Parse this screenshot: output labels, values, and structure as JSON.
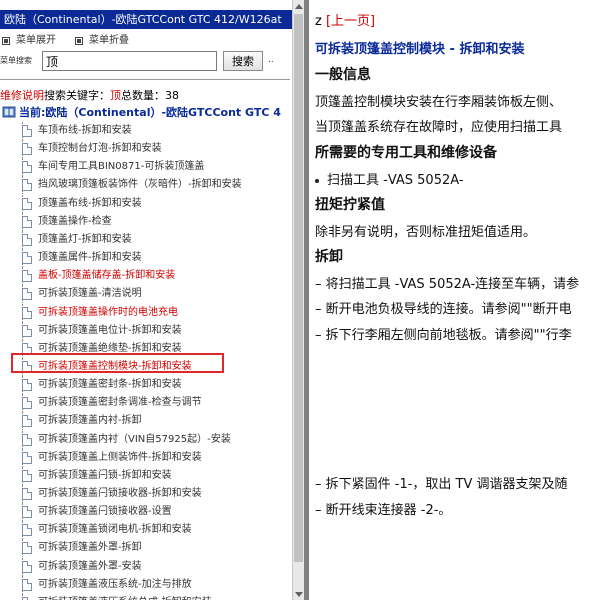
{
  "left_pane": {
    "title": "欧陆（Continental）-欧陆GTCCont GTC 412/W126at",
    "expand_all": "菜单展开",
    "collapse_all": "菜单折叠",
    "search_label": "菜单搜索",
    "search_value": "顶",
    "search_button": "搜索",
    "search_more": "..",
    "result_prefix": "维修说明",
    "result_keyword_label": "搜索关键字：",
    "result_keyword": "顶",
    "result_count_label": "总数量：",
    "result_count": "38",
    "current_label": "当前:欧陆（Continental）-欧陆GTCCont GTC 4",
    "tree_items": [
      {
        "label": "车顶布线-拆卸和安装",
        "state": "normal"
      },
      {
        "label": "车顶控制台灯泡-拆卸和安装",
        "state": "normal"
      },
      {
        "label": "车间专用工具BIN0871-可拆装顶篷盖",
        "state": "normal"
      },
      {
        "label": "挡风玻璃顶篷板装饰件（灰暗件）-拆卸和安装",
        "state": "normal"
      },
      {
        "label": "顶篷盖布线-拆卸和安装",
        "state": "normal"
      },
      {
        "label": "顶篷盖操作-检查",
        "state": "normal"
      },
      {
        "label": "顶篷盖灯-拆卸和安装",
        "state": "normal"
      },
      {
        "label": "顶篷盖属件-拆卸和安装",
        "state": "normal"
      },
      {
        "label": "盖板-顶篷盖储存盖-拆卸和安装",
        "state": "red"
      },
      {
        "label": "可拆装顶篷盖-清洁说明",
        "state": "normal"
      },
      {
        "label": "可拆装顶篷盖操作时的电池充电",
        "state": "red"
      },
      {
        "label": "可拆装顶篷盖电位计-拆卸和安装",
        "state": "normal"
      },
      {
        "label": "可拆装顶篷盖绝缘垫-拆卸和安装",
        "state": "normal"
      },
      {
        "label": "可拆装顶篷盖控制模块-拆卸和安装",
        "state": "selected"
      },
      {
        "label": "可拆装顶篷盖密封条-拆卸和安装",
        "state": "normal"
      },
      {
        "label": "可拆装顶篷盖密封条调准-检查与调节",
        "state": "normal"
      },
      {
        "label": "可拆装顶篷盖内衬-拆卸",
        "state": "normal"
      },
      {
        "label": "可拆装顶篷盖内衬（VIN自57925起）-安装",
        "state": "normal"
      },
      {
        "label": "可拆装顶篷盖上侧装饰件-拆卸和安装",
        "state": "normal"
      },
      {
        "label": "可拆装顶篷盖闩锁-拆卸和安装",
        "state": "normal"
      },
      {
        "label": "可拆装顶篷盖闩锁接收器-拆卸和安装",
        "state": "normal"
      },
      {
        "label": "可拆装顶篷盖闩锁接收器-设置",
        "state": "normal"
      },
      {
        "label": "可拆装顶篷盖锁闭电机-拆卸和安装",
        "state": "normal"
      },
      {
        "label": "可拆装顶篷盖外罩-拆卸",
        "state": "normal"
      },
      {
        "label": "可拆装顶篷盖外罩-安装",
        "state": "normal"
      },
      {
        "label": "可拆装顶篷盖液压系统-加注与排放",
        "state": "normal"
      },
      {
        "label": "可拆装顶篷盖液压系统总成-拆卸和安装",
        "state": "normal"
      }
    ]
  },
  "right_pane": {
    "nav_z": "z",
    "nav_prev": "[上一页]",
    "doc_title": "可拆装顶篷盖控制模块 - 拆卸和安装",
    "heading_general": "一般信息",
    "general_line1": "顶篷盖控制模块安装在行李厢装饰板左侧、",
    "general_line2": "当顶篷盖系统存在故障时，应使用扫描工具",
    "heading_tools": "所需要的专用工具和维修设备",
    "tool_item": "扫描工具 -VAS 5052A-",
    "heading_torque": "扭矩拧紧值",
    "torque_text": "除非另有说明，否则标准扭矩值适用。",
    "heading_remove": "拆卸",
    "step1": "– 将扫描工具 -VAS 5052A-连接至车辆，请参",
    "step2": "– 断开电池负极导线的连接。请参阅\"\"断开电",
    "step3": "– 拆下行李厢左侧向前地毯板。请参阅\"\"行李",
    "step4": "– 拆下紧固件 -1-，取出 TV 调谐器支架及随",
    "step5": "– 断开线束连接器 -2-。"
  },
  "colors": {
    "title_bar": "#0b2a96",
    "link_blue": "#0a2a9a",
    "red": "#d00000",
    "selection_box": "#e0282a"
  }
}
